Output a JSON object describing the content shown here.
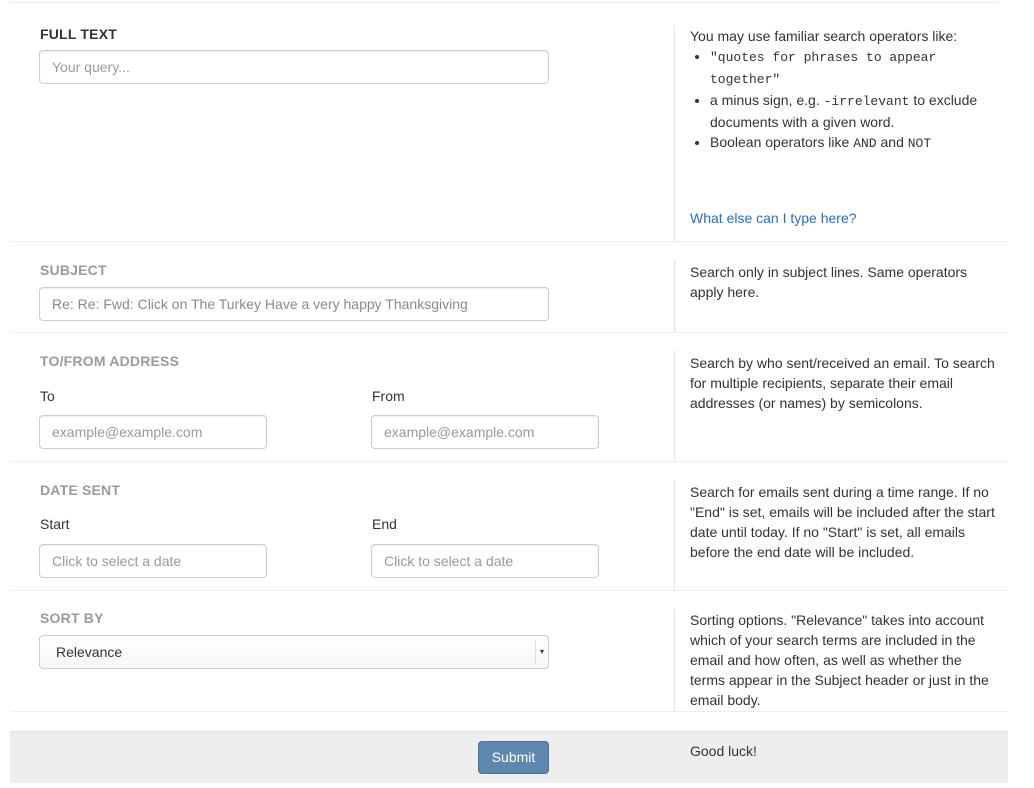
{
  "full_text": {
    "title": "FULL TEXT",
    "placeholder": "Your query...",
    "help_intro": "You may use familiar search operators like:",
    "help_items": [
      {
        "mono": "\"quotes for phrases to appear together\"",
        "text": ""
      },
      {
        "pre": "a minus sign, e.g. ",
        "mono": "-irrelevant",
        "text": " to exclude documents with a given word."
      },
      {
        "pre": "Boolean operators like ",
        "mono1": "AND",
        "mid": " and ",
        "mono2": "NOT"
      }
    ],
    "help_link": "What else can I type here?"
  },
  "subject": {
    "title": "SUBJECT",
    "value": "Re: Re: Fwd: Click on The Turkey Have a very happy Thanksgiving",
    "help": "Search only in subject lines. Same operators apply here."
  },
  "address": {
    "title": "TO/FROM ADDRESS",
    "to_label": "To",
    "from_label": "From",
    "to_placeholder": "example@example.com",
    "from_placeholder": "example@example.com",
    "help": "Search by who sent/received an email. To search for multiple recipients, separate their email addresses (or names) by semicolons."
  },
  "date": {
    "title": "DATE SENT",
    "start_label": "Start",
    "end_label": "End",
    "start_placeholder": "Click to select a date",
    "end_placeholder": "Click to select a date",
    "help": "Search for emails sent during a time range. If no \"End\" is set, emails will be included after the start date until today. If no \"Start\" is set, all emails before the end date will be included."
  },
  "sort": {
    "title": "SORT BY",
    "selected": "Relevance",
    "help": "Sorting options. \"Relevance\" takes into account which of your search terms are included in the email and how often, as well as whether the terms appear in the Subject header or just in the email body."
  },
  "footer": {
    "submit_label": "Submit",
    "help": "Good luck!"
  },
  "colors": {
    "accent": "#5d87ae",
    "link": "#2a6ebb",
    "muted_title": "#9a9a9a"
  }
}
